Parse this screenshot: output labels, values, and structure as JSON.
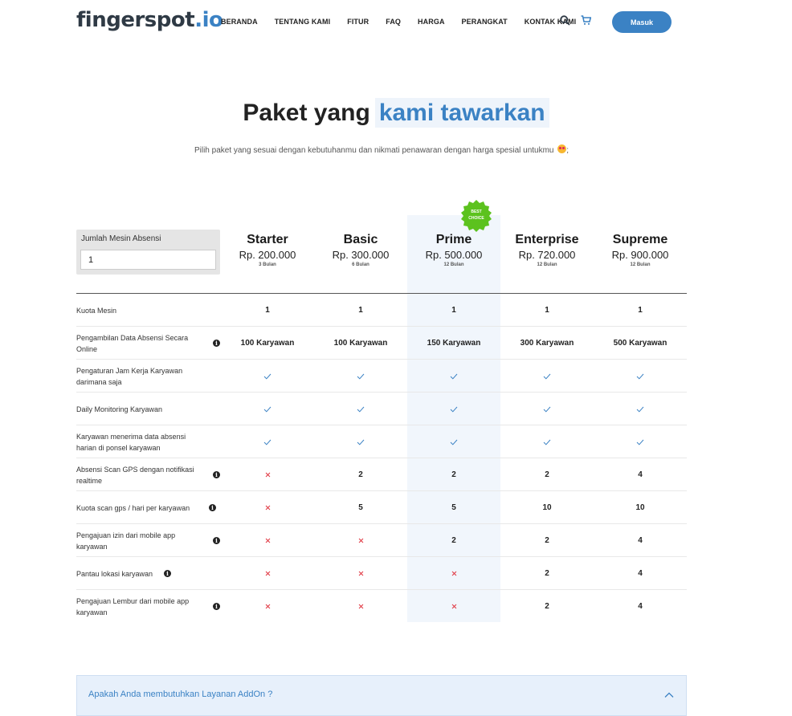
{
  "brand": {
    "logo_main": "fingerspot",
    "logo_suffix": ".io"
  },
  "nav": {
    "items": [
      "BERANDA",
      "TENTANG KAMI",
      "FITUR",
      "FAQ",
      "HARGA",
      "PERANGKAT",
      "KONTAK KAMI"
    ],
    "login_label": "Masuk"
  },
  "hero": {
    "title_a": "Paket yang",
    "title_b": "kami tawarkan",
    "subtitle": "Pilih paket yang sesuai dengan kebutuhanmu dan nikmati penawaran dengan harga spesial untukmu",
    "subtitle_end": ";"
  },
  "quantity": {
    "label": "Jumlah Mesin Absensi",
    "value": "1"
  },
  "badge": {
    "line1": "BEST",
    "line2": "CHOICE",
    "color": "#5cc21e"
  },
  "plans": [
    {
      "name": "Starter",
      "price": "Rp. 200.000",
      "period": "3 Bulan"
    },
    {
      "name": "Basic",
      "price": "Rp. 300.000",
      "period": "6 Bulan"
    },
    {
      "name": "Prime",
      "price": "Rp. 500.000",
      "period": "12 Bulan"
    },
    {
      "name": "Enterprise",
      "price": "Rp. 720.000",
      "period": "12 Bulan"
    },
    {
      "name": "Supreme",
      "price": "Rp. 900.000",
      "period": "12 Bulan"
    }
  ],
  "features": [
    {
      "label": "Kuota Mesin",
      "info": false,
      "values": [
        "1",
        "1",
        "1",
        "1",
        "1"
      ]
    },
    {
      "label": "Pengambilan Data Absensi Secara Online",
      "info": true,
      "values": [
        "100 Karyawan",
        "100 Karyawan",
        "150 Karyawan",
        "300 Karyawan",
        "500 Karyawan"
      ]
    },
    {
      "label": "Pengaturan Jam Kerja Karyawan darimana saja",
      "info": false,
      "values": [
        "check",
        "check",
        "check",
        "check",
        "check"
      ]
    },
    {
      "label": "Daily Monitoring Karyawan",
      "info": false,
      "values": [
        "check",
        "check",
        "check",
        "check",
        "check"
      ]
    },
    {
      "label": "Karyawan menerima data absensi harian di ponsel karyawan",
      "info": false,
      "values": [
        "check",
        "check",
        "check",
        "check",
        "check"
      ]
    },
    {
      "label": "Absensi Scan GPS dengan notifikasi realtime",
      "info": true,
      "values": [
        "cross",
        "2",
        "2",
        "2",
        "4"
      ]
    },
    {
      "label": "Kuota scan gps / hari per karyawan",
      "info": true,
      "values": [
        "cross",
        "5",
        "5",
        "10",
        "10"
      ]
    },
    {
      "label": "Pengajuan izin dari mobile app karyawan",
      "info": true,
      "values": [
        "cross",
        "cross",
        "2",
        "2",
        "4"
      ]
    },
    {
      "label": "Pantau lokasi karyawan",
      "info": true,
      "values": [
        "cross",
        "cross",
        "cross",
        "2",
        "4"
      ]
    },
    {
      "label": "Pengajuan Lembur dari mobile app karyawan",
      "info": true,
      "values": [
        "cross",
        "cross",
        "cross",
        "2",
        "4"
      ]
    }
  ],
  "addon": {
    "question": "Apakah Anda membutuhkan Layanan AddOn ?"
  },
  "colors": {
    "accent": "#3b82c4",
    "check": "#3b82c4",
    "cross": "#e0353f",
    "prime_highlight": "#f1f6fc"
  }
}
